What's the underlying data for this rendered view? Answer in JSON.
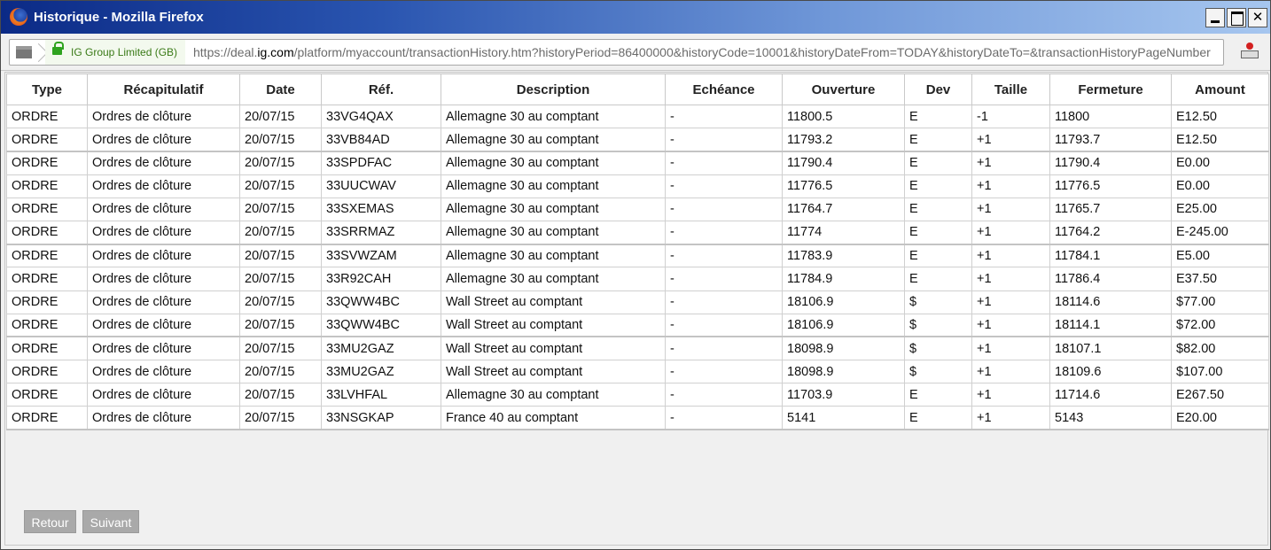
{
  "window": {
    "title": "Historique - Mozilla Firefox"
  },
  "navbar": {
    "identity": "IG Group Limited (GB)",
    "url_prefix": "https://deal.",
    "url_domain": "ig.com",
    "url_rest": "/platform/myaccount/transactionHistory.htm?historyPeriod=86400000&historyCode=10001&historyDateFrom=TODAY&historyDateTo=&transactionHistoryPageNumber"
  },
  "table": {
    "headers": [
      "Type",
      "Récapitulatif",
      "Date",
      "Réf.",
      "Description",
      "Echéance",
      "Ouverture",
      "Dev",
      "Taille",
      "Fermeture",
      "Amount"
    ],
    "rows": [
      [
        "ORDRE",
        "Ordres de clôture",
        "20/07/15",
        "33VG4QAX",
        "Allemagne 30 au comptant",
        "-",
        "11800.5",
        "E",
        "-1",
        "11800",
        "E12.50"
      ],
      [
        "ORDRE",
        "Ordres de clôture",
        "20/07/15",
        "33VB84AD",
        "Allemagne 30 au comptant",
        "-",
        "11793.2",
        "E",
        "+1",
        "11793.7",
        "E12.50"
      ],
      [
        "ORDRE",
        "Ordres de clôture",
        "20/07/15",
        "33SPDFAC",
        "Allemagne 30 au comptant",
        "-",
        "11790.4",
        "E",
        "+1",
        "11790.4",
        "E0.00"
      ],
      [
        "ORDRE",
        "Ordres de clôture",
        "20/07/15",
        "33UUCWAV",
        "Allemagne 30 au comptant",
        "-",
        "11776.5",
        "E",
        "+1",
        "11776.5",
        "E0.00"
      ],
      [
        "ORDRE",
        "Ordres de clôture",
        "20/07/15",
        "33SXEMAS",
        "Allemagne 30 au comptant",
        "-",
        "11764.7",
        "E",
        "+1",
        "11765.7",
        "E25.00"
      ],
      [
        "ORDRE",
        "Ordres de clôture",
        "20/07/15",
        "33SRRMAZ",
        "Allemagne 30 au comptant",
        "-",
        "11774",
        "E",
        "+1",
        "11764.2",
        "E-245.00"
      ],
      [
        "ORDRE",
        "Ordres de clôture",
        "20/07/15",
        "33SVWZAM",
        "Allemagne 30 au comptant",
        "-",
        "11783.9",
        "E",
        "+1",
        "11784.1",
        "E5.00"
      ],
      [
        "ORDRE",
        "Ordres de clôture",
        "20/07/15",
        "33R92CAH",
        "Allemagne 30 au comptant",
        "-",
        "11784.9",
        "E",
        "+1",
        "11786.4",
        "E37.50"
      ],
      [
        "ORDRE",
        "Ordres de clôture",
        "20/07/15",
        "33QWW4BC",
        "Wall Street au comptant",
        "-",
        "18106.9",
        "$",
        "+1",
        "18114.6",
        "$77.00"
      ],
      [
        "ORDRE",
        "Ordres de clôture",
        "20/07/15",
        "33QWW4BC",
        "Wall Street au comptant",
        "-",
        "18106.9",
        "$",
        "+1",
        "18114.1",
        "$72.00"
      ],
      [
        "ORDRE",
        "Ordres de clôture",
        "20/07/15",
        "33MU2GAZ",
        "Wall Street au comptant",
        "-",
        "18098.9",
        "$",
        "+1",
        "18107.1",
        "$82.00"
      ],
      [
        "ORDRE",
        "Ordres de clôture",
        "20/07/15",
        "33MU2GAZ",
        "Wall Street au comptant",
        "-",
        "18098.9",
        "$",
        "+1",
        "18109.6",
        "$107.00"
      ],
      [
        "ORDRE",
        "Ordres de clôture",
        "20/07/15",
        "33LVHFAL",
        "Allemagne 30 au comptant",
        "-",
        "11703.9",
        "E",
        "+1",
        "11714.6",
        "E267.50"
      ],
      [
        "ORDRE",
        "Ordres de clôture",
        "20/07/15",
        "33NSGKAP",
        "France 40 au comptant",
        "-",
        "5141",
        "E",
        "+1",
        "5143",
        "E20.00"
      ]
    ]
  },
  "pager": {
    "prev_label": "Retour",
    "next_label": "Suivant"
  }
}
